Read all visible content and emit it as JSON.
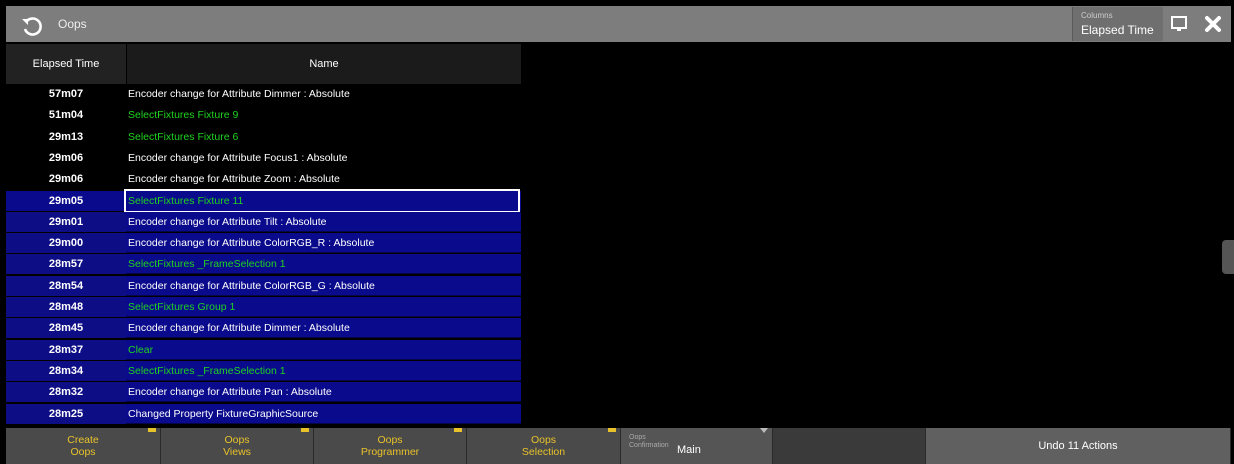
{
  "window": {
    "title": "Oops"
  },
  "columns": {
    "label": "Columns",
    "value": "Elapsed Time"
  },
  "table": {
    "headers": [
      "Elapsed Time",
      "Name"
    ],
    "rows": [
      {
        "time": "57m07",
        "name": "Encoder change for Attribute Dimmer : Absolute",
        "green": false,
        "state": "black"
      },
      {
        "time": "51m04",
        "name": "SelectFixtures Fixture 9",
        "green": true,
        "state": "black"
      },
      {
        "time": "29m13",
        "name": "SelectFixtures Fixture 6",
        "green": true,
        "state": "black"
      },
      {
        "time": "29m06",
        "name": "Encoder change for Attribute Focus1 : Absolute",
        "green": false,
        "state": "black"
      },
      {
        "time": "29m06",
        "name": "Encoder change for Attribute Zoom : Absolute",
        "green": false,
        "state": "black"
      },
      {
        "time": "29m05",
        "name": "SelectFixtures Fixture 11",
        "green": true,
        "state": "selected"
      },
      {
        "time": "29m01",
        "name": "Encoder change for Attribute Tilt : Absolute",
        "green": false,
        "state": "blue"
      },
      {
        "time": "29m00",
        "name": "Encoder change for Attribute ColorRGB_R : Absolute",
        "green": false,
        "state": "blue"
      },
      {
        "time": "28m57",
        "name": "SelectFixtures _FrameSelection 1",
        "green": true,
        "state": "blue"
      },
      {
        "time": "28m54",
        "name": "Encoder change for Attribute ColorRGB_G : Absolute",
        "green": false,
        "state": "blue"
      },
      {
        "time": "28m48",
        "name": "SelectFixtures Group 1",
        "green": true,
        "state": "blue"
      },
      {
        "time": "28m45",
        "name": "Encoder change for Attribute Dimmer : Absolute",
        "green": false,
        "state": "blue"
      },
      {
        "time": "28m37",
        "name": "Clear",
        "green": true,
        "state": "blue"
      },
      {
        "time": "28m34",
        "name": "SelectFixtures _FrameSelection 1",
        "green": true,
        "state": "blue"
      },
      {
        "time": "28m32",
        "name": "Encoder change for Attribute Pan : Absolute",
        "green": false,
        "state": "blue"
      },
      {
        "time": "28m25",
        "name": "Changed Property FixtureGraphicSource",
        "green": false,
        "state": "blue"
      }
    ]
  },
  "bottom": {
    "create_oops": [
      "Create",
      "Oops"
    ],
    "oops_views": [
      "Oops",
      "Views"
    ],
    "oops_programmer": [
      "Oops",
      "Programmer"
    ],
    "oops_selection": [
      "Oops",
      "Selection"
    ],
    "confirmation_small": [
      "Oops",
      "Confirmation"
    ],
    "confirmation_value": "Main",
    "undo_label": "Undo 11 Actions"
  },
  "colors": {
    "accent": "#e8c22a",
    "selection_blue": "#0a0a8c",
    "green_text": "#1fd41f"
  },
  "icons": [
    "undo-icon",
    "monitor-icon",
    "close-icon"
  ]
}
